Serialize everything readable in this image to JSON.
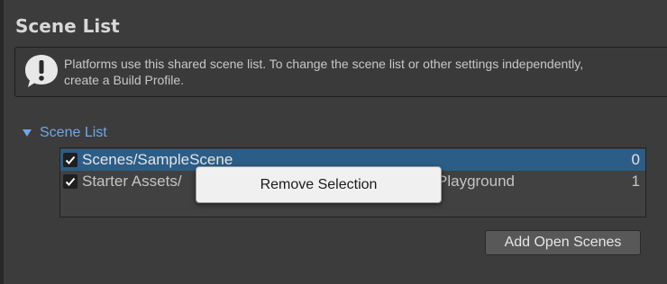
{
  "section": {
    "title": "Scene List"
  },
  "helpbox": {
    "icon": "exclamation-icon",
    "text": "Platforms use this shared scene list. To change the scene list or other settings independently,\ncreate a Build Profile."
  },
  "foldout": {
    "label": "Scene List",
    "expanded": true,
    "color": "#6ea6ee"
  },
  "scenes": [
    {
      "name": "Scenes/SampleScene",
      "index": "0",
      "checked": true,
      "selected": true
    },
    {
      "name_left": "Starter Assets/",
      "name_right": "Playground",
      "index": "1",
      "checked": true,
      "selected": false
    }
  ],
  "context_menu": {
    "items": [
      {
        "label": "Remove Selection"
      }
    ]
  },
  "buttons": {
    "add_open_scenes": "Add Open Scenes"
  },
  "colors": {
    "selection": "#2c5d87",
    "panel": "#3c3c3c"
  }
}
